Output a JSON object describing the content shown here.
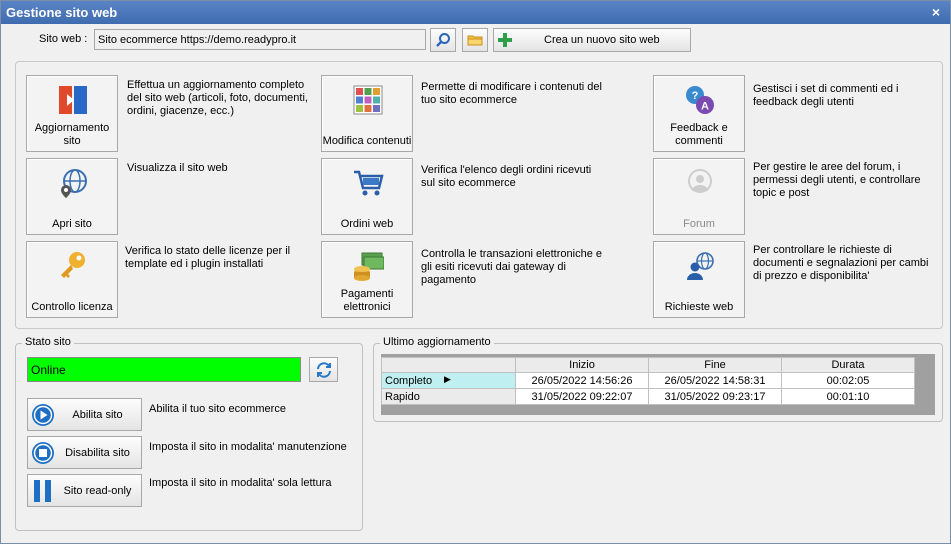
{
  "window": {
    "title": "Gestione sito web",
    "close": "×"
  },
  "site": {
    "label": "Sito web :",
    "value": "Sito ecommerce https://demo.readypro.it",
    "new_site_label": "Crea un nuovo sito web"
  },
  "tiles": {
    "aggiornamento": {
      "label": "Aggiornamento sito",
      "desc": "Effettua un aggiornamento completo del sito web (articoli, foto, documenti, ordini, giacenze, ecc.)"
    },
    "apri": {
      "label": "Apri sito",
      "desc": "Visualizza il sito web"
    },
    "licenza": {
      "label": "Controllo licenza",
      "desc": "Verifica lo stato delle licenze per il template ed i plugin installati"
    },
    "contenuti": {
      "label": "Modifica contenuti",
      "desc": "Permette di modificare i contenuti del tuo sito ecommerce"
    },
    "ordini": {
      "label": "Ordini web",
      "desc": "Verifica l'elenco degli ordini ricevuti sul sito ecommerce"
    },
    "pagamenti": {
      "label": "Pagamenti elettronici",
      "desc": "Controlla le transazioni elettroniche e gli esiti ricevuti dai gateway di pagamento"
    },
    "feedback": {
      "label": "Feedback e commenti",
      "desc": "Gestisci i set di commenti ed i feedback degli utenti"
    },
    "forum": {
      "label": "Forum",
      "desc": "Per gestire le aree del forum, i permessi degli utenti, e controllare topic e post"
    },
    "richieste": {
      "label": "Richieste web",
      "desc": "Per controllare le richieste di documenti e segnalazioni per cambi di prezzo e disponibilita'"
    }
  },
  "stato": {
    "title": "Stato sito",
    "status": "Online",
    "status_color": "#00ff00",
    "enable": {
      "label": "Abilita sito",
      "desc": "Abilita il tuo sito ecommerce"
    },
    "disable": {
      "label": "Disabilita sito",
      "desc": "Imposta il sito in modalita' manutenzione"
    },
    "readonly": {
      "label": "Sito read-only",
      "desc": "Imposta il sito in modalita' sola lettura"
    }
  },
  "ultimo": {
    "title": "Ultimo aggiornamento",
    "columns": [
      "Inizio",
      "Fine",
      "Durata"
    ],
    "rows": [
      {
        "name": "Completo",
        "inizio": "26/05/2022 14:56:26",
        "fine": "26/05/2022 14:58:31",
        "durata": "00:02:05",
        "selected": true
      },
      {
        "name": "Rapido",
        "inizio": "31/05/2022 09:22:07",
        "fine": "31/05/2022 09:23:17",
        "durata": "00:01:10",
        "selected": false
      }
    ]
  },
  "colors": {
    "accent": "#3f6bb0",
    "online": "#00ff00",
    "selected_row": "#bfeff0",
    "blue_icon": "#1e6fc4"
  }
}
